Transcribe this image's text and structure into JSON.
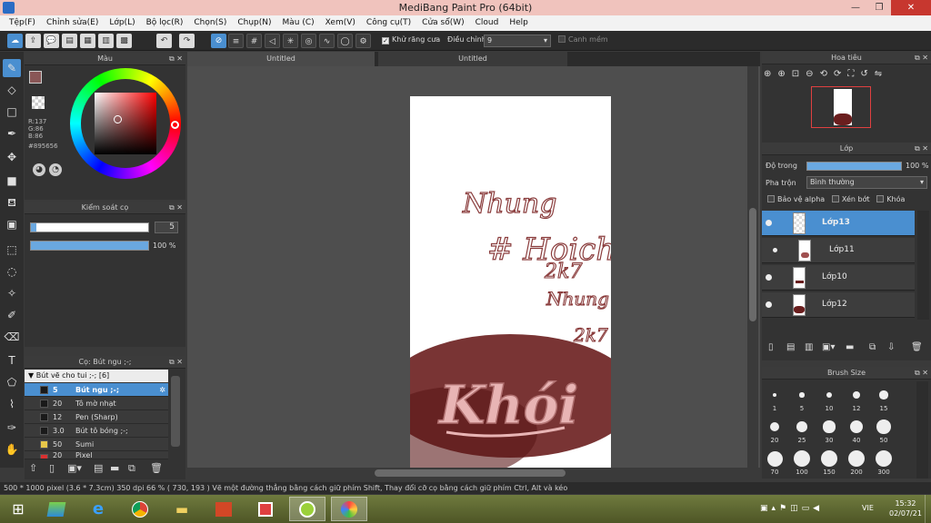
{
  "window": {
    "title": "MediBang Paint Pro (64bit)"
  },
  "menu": [
    "Tệp(F)",
    "Chỉnh sửa(E)",
    "Lớp(L)",
    "Bộ lọc(R)",
    "Chọn(S)",
    "Chụp(N)",
    "Màu (C)",
    "Xem(V)",
    "Công cụ(T)",
    "Cửa sổ(W)",
    "Cloud",
    "Help"
  ],
  "toolbar": {
    "antialias_label": "Khử răng cưa",
    "correction_label": "Điều chỉnh",
    "correction_value": "9",
    "snap_label": "Canh mềm"
  },
  "color_panel": {
    "title": "Màu",
    "r": "R:137",
    "g": "G:86",
    "b": "B:86",
    "hex": "#895656",
    "fg_color": "#895656",
    "bg_color": "#8fb0e0"
  },
  "brush_control": {
    "title": "Kiểm soát cọ",
    "size_value": "5",
    "opacity_value": "100 %",
    "size_fraction": 0.05,
    "opacity_fraction": 1.0
  },
  "brush_list": {
    "title": "Cọ: Bút ngu ;-;",
    "group": "Bút vẽ cho tui ;-; [6]",
    "items": [
      {
        "size": "5",
        "name": "Bút ngu ;-;",
        "color": "#1a1a1a",
        "selected": true
      },
      {
        "size": "20",
        "name": "Tô mờ nhạt",
        "color": "#1a1a1a",
        "selected": false
      },
      {
        "size": "12",
        "name": "Pen (Sharp)",
        "color": "#1a1a1a",
        "selected": false
      },
      {
        "size": "3.0",
        "name": "Bút tô bóng ;-;",
        "color": "#1a1a1a",
        "selected": false
      },
      {
        "size": "50",
        "name": "Sumi",
        "color": "#e8c84a",
        "selected": false
      },
      {
        "size": "20",
        "name": "Pixel",
        "color": "#d83030",
        "selected": false
      }
    ]
  },
  "tabs": [
    "Untitled",
    "Untitled"
  ],
  "canvas": {
    "scribble_texts": [
      "Nhung",
      "# Hoich",
      "2k7",
      "Nhung",
      "2k7"
    ],
    "big_text": "Khói",
    "blob_color": "#6a1e1e"
  },
  "navigator": {
    "title": "Hoa tiêu"
  },
  "layers": {
    "title": "Lớp",
    "opacity_label": "Độ trong",
    "opacity_value": "100 %",
    "blend_label": "Pha trộn",
    "blend_value": "Bình thường",
    "protect_alpha": "Bảo vệ alpha",
    "clip": "Xén bớt",
    "lock": "Khóa",
    "items": [
      {
        "name": "Lớp13",
        "selected": true
      },
      {
        "name": "Lớp11",
        "selected": false
      },
      {
        "name": "Lớp10",
        "selected": false
      },
      {
        "name": "Lớp12",
        "selected": false
      }
    ]
  },
  "brush_size": {
    "title": "Brush Size",
    "sizes": [
      "1",
      "5",
      "10",
      "12",
      "15",
      "20",
      "25",
      "30",
      "40",
      "50",
      "70",
      "100",
      "150",
      "200",
      "300"
    ]
  },
  "status": {
    "text": "500 * 1000 pixel  (3.6 * 7.3cm)  350 dpi  66 %  ( 730, 193 )  Vẽ một đường thẳng bằng cách giữ phím Shift, Thay đổi cỡ cọ bằng cách giữ phím Ctrl, Alt và kéo"
  },
  "taskbar": {
    "lang": "VIE",
    "time": "15:32",
    "date": "02/07/21"
  }
}
